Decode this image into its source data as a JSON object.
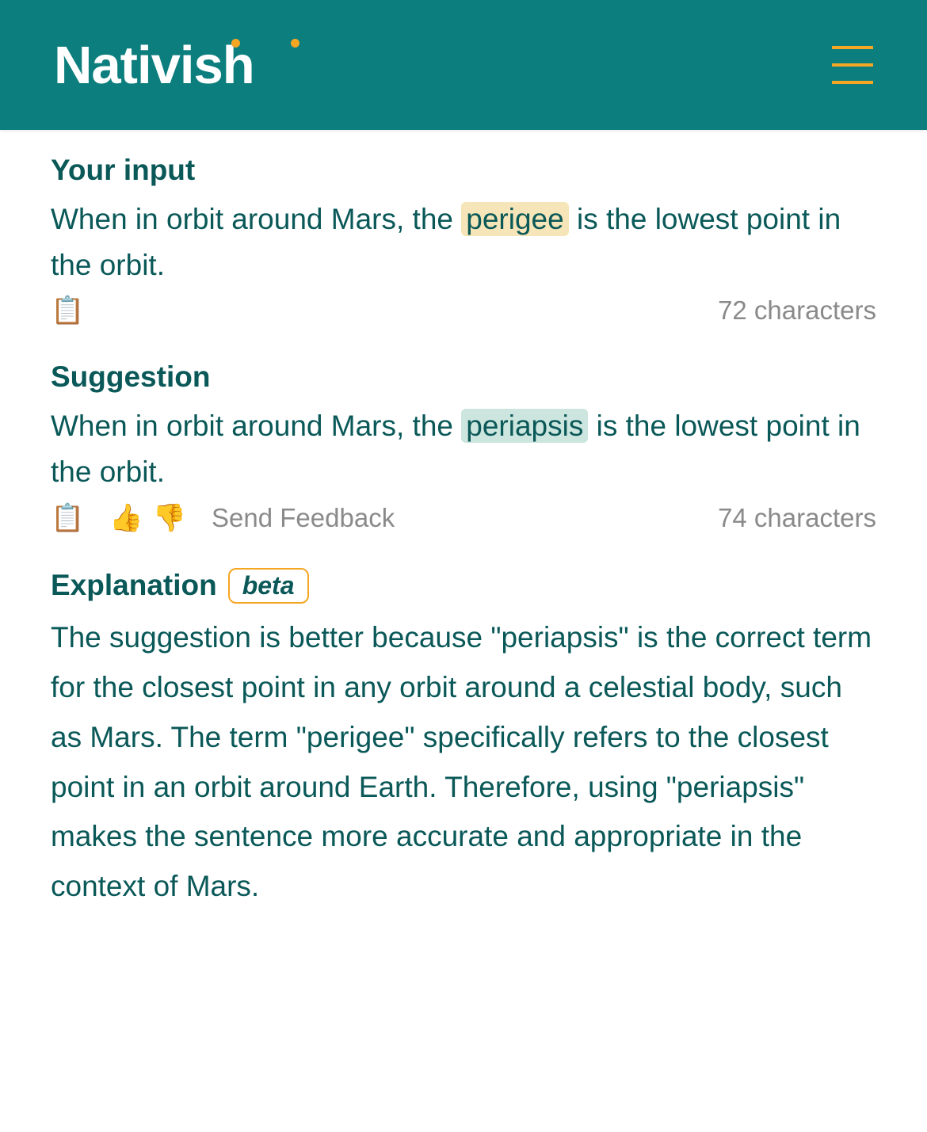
{
  "header": {
    "brand": "Nativish"
  },
  "input_section": {
    "title": "Your input",
    "text_before": "When in orbit around Mars, the ",
    "highlighted": "perigee",
    "text_after": " is the lowest point in the orbit.",
    "char_count": "72 characters"
  },
  "suggestion_section": {
    "title": "Suggestion",
    "text_before": "When in orbit around Mars, the ",
    "highlighted": "periapsis",
    "text_after": " is the lowest point in the orbit.",
    "feedback_label": "Send Feedback",
    "char_count": "74 characters"
  },
  "explanation_section": {
    "title": "Explanation",
    "badge": "beta",
    "text": "The suggestion is better because \"periapsis\" is the correct term for the closest point in any orbit around a celestial body, such as Mars. The term \"perigee\" specifically refers to the closest point in an orbit around Earth. Therefore, using \"periapsis\" makes the sentence more accurate and appropriate in the context of Mars."
  }
}
